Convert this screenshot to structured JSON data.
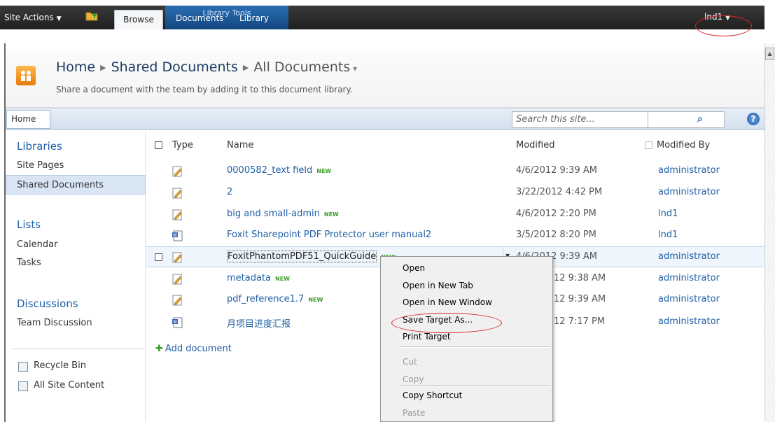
{
  "ribbon": {
    "site_actions": "Site Actions",
    "browse_tab": "Browse",
    "library_tools": "Library Tools",
    "documents_tab": "Documents",
    "library_tab": "Library",
    "user": "lnd1"
  },
  "header": {
    "breadcrumb": [
      "Home",
      "Shared Documents",
      "All Documents"
    ],
    "description": "Share a document with the team by adding it to this document library."
  },
  "nav": {
    "home_tab": "Home",
    "search_placeholder": "Search this site..."
  },
  "sidebar": {
    "libraries_heading": "Libraries",
    "libraries": [
      "Site Pages",
      "Shared Documents"
    ],
    "lists_heading": "Lists",
    "lists": [
      "Calendar",
      "Tasks"
    ],
    "discussions_heading": "Discussions",
    "discussions": [
      "Team Discussion"
    ],
    "recycle_bin": "Recycle Bin",
    "all_site_content": "All Site Content"
  },
  "list": {
    "columns": [
      "Type",
      "Name",
      "Modified",
      "Modified By"
    ],
    "rows": [
      {
        "name": "0000582_text field",
        "new": true,
        "modified": "4/6/2012 9:39 AM",
        "by": "administrator",
        "icon": "edit-doc-icon"
      },
      {
        "name": "2",
        "new": false,
        "modified": "3/22/2012 4:42 PM",
        "by": "administrator",
        "icon": "edit-doc-icon"
      },
      {
        "name": "big and small-admin",
        "new": true,
        "modified": "4/6/2012 2:20 PM",
        "by": "lnd1",
        "icon": "edit-doc-icon"
      },
      {
        "name": "Foxit Sharepoint PDF Protector user manual2",
        "new": false,
        "modified": "3/5/2012 8:20 PM",
        "by": "lnd1",
        "icon": "word-doc-icon"
      },
      {
        "name": "FoxitPhantomPDF51_QuickGuide",
        "new": true,
        "modified": "4/6/2012 9:39 AM",
        "by": "administrator",
        "icon": "edit-doc-icon"
      },
      {
        "name": "metadata",
        "new": true,
        "modified": "12 9:38 AM",
        "by": "administrator",
        "icon": "edit-doc-icon"
      },
      {
        "name": "pdf_reference1.7",
        "new": true,
        "modified": "12 9:39 AM",
        "by": "administrator",
        "icon": "edit-doc-icon"
      },
      {
        "name": "月项目进度汇报",
        "new": false,
        "modified": "12 7:17 PM",
        "by": "administrator",
        "icon": "word-doc-icon"
      }
    ],
    "new_badge": "NEW",
    "add_document": "Add document"
  },
  "context_menu": {
    "items": [
      {
        "label": "Open",
        "disabled": false
      },
      {
        "label": "Open in New Tab",
        "disabled": false
      },
      {
        "label": "Open in New Window",
        "disabled": false
      },
      {
        "label": "Save Target As...",
        "disabled": false
      },
      {
        "label": "Print Target",
        "disabled": false
      },
      {
        "label": "Cut",
        "disabled": true
      },
      {
        "label": "Copy",
        "disabled": true
      },
      {
        "label": "Copy Shortcut",
        "disabled": false
      },
      {
        "label": "Paste",
        "disabled": true
      }
    ]
  },
  "colors": {
    "link": "#1f5fa6",
    "ribbon_dark": "#2b2b2b",
    "library_tools_blue": "#1f5aa0",
    "annotation_red": "#d9262a"
  }
}
